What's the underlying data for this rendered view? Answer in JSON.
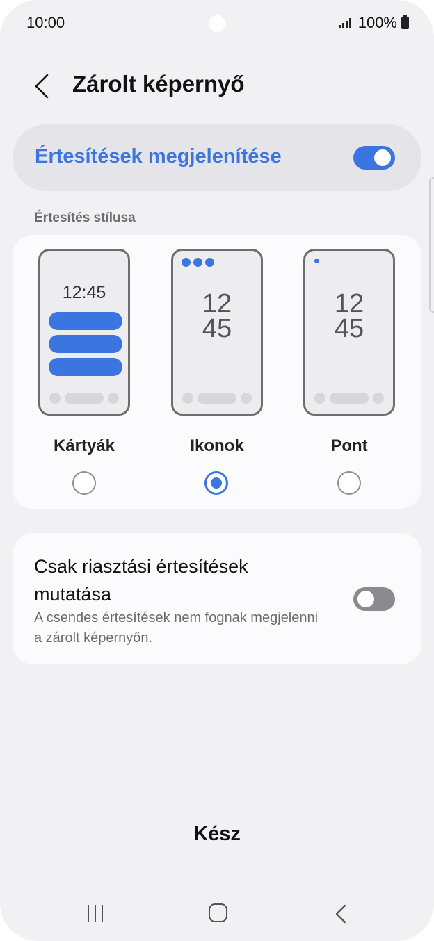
{
  "status_bar": {
    "time": "10:00",
    "battery": "100%"
  },
  "header": {
    "title": "Zárolt képernyő",
    "back_icon": "chevron-left-icon"
  },
  "master_switch": {
    "label": "Értesítések megjelenítése",
    "enabled": true
  },
  "notification_style": {
    "section_label": "Értesítés stílusa",
    "options": [
      {
        "label": "Kártyák",
        "preview_time": "12:45",
        "selected": false
      },
      {
        "label": "Ikonok",
        "preview_time_hour": "12",
        "preview_time_min": "45",
        "selected": true
      },
      {
        "label": "Pont",
        "preview_time_hour": "12",
        "preview_time_min": "45",
        "selected": false
      }
    ]
  },
  "alert_only": {
    "title": "Csak riasztási értesítések mutatása",
    "description": "A csendes értesítések nem fognak megjelenni a zárolt képernyőn.",
    "enabled": false
  },
  "done_label": "Kész",
  "navigation": {
    "recents": "recents-icon",
    "home": "home-icon",
    "back": "back-icon"
  },
  "colors": {
    "accent": "#3b76e0",
    "background": "#f1f1f4",
    "card": "#fbfbfd",
    "toggle_off": "#8a8a8f"
  }
}
